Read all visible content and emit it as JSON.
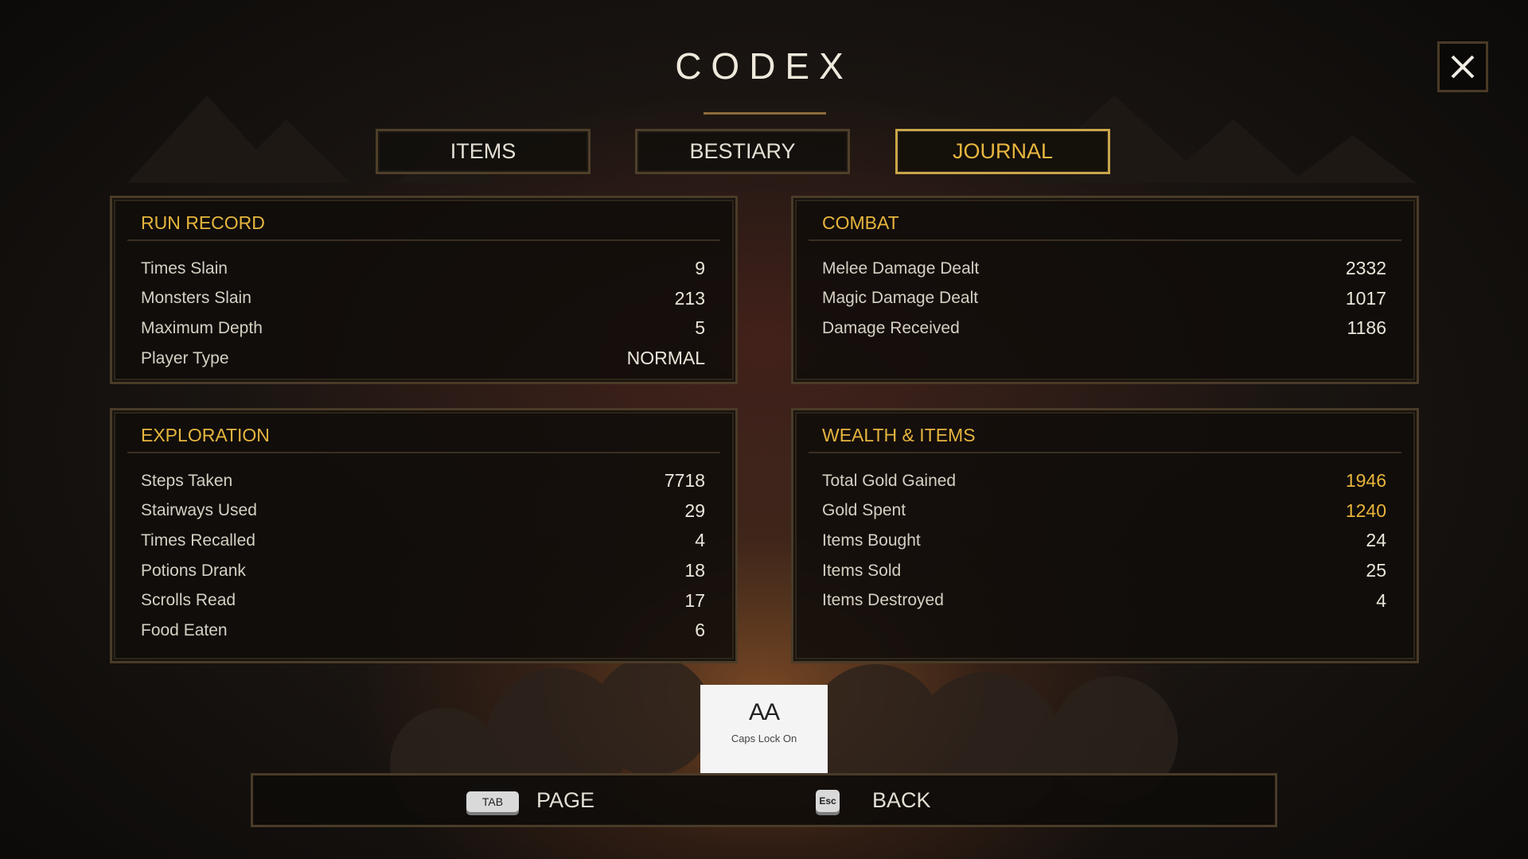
{
  "title": "CODEX",
  "tabs": [
    {
      "label": "ITEMS",
      "active": false
    },
    {
      "label": "BESTIARY",
      "active": false
    },
    {
      "label": "JOURNAL",
      "active": true
    }
  ],
  "panels": {
    "run_record": {
      "title": "RUN RECORD",
      "rows": [
        {
          "label": "Times Slain",
          "value": "9"
        },
        {
          "label": "Monsters Slain",
          "value": "213"
        },
        {
          "label": "Maximum Depth",
          "value": "5"
        },
        {
          "label": "Player Type",
          "value": "NORMAL"
        }
      ]
    },
    "combat": {
      "title": "COMBAT",
      "rows": [
        {
          "label": "Melee Damage Dealt",
          "value": "2332"
        },
        {
          "label": "Magic Damage Dealt",
          "value": "1017"
        },
        {
          "label": "Damage Received",
          "value": "1186"
        }
      ]
    },
    "exploration": {
      "title": "EXPLORATION",
      "rows": [
        {
          "label": "Steps Taken",
          "value": "7718"
        },
        {
          "label": "Stairways Used",
          "value": "29"
        },
        {
          "label": "Times Recalled",
          "value": "4"
        },
        {
          "label": "Potions Drank",
          "value": "18"
        },
        {
          "label": "Scrolls Read",
          "value": "17"
        },
        {
          "label": "Food Eaten",
          "value": "6"
        }
      ]
    },
    "wealth": {
      "title": "WEALTH & ITEMS",
      "rows": [
        {
          "label": "Total Gold Gained",
          "value": "1946"
        },
        {
          "label": "Gold Spent",
          "value": "1240"
        },
        {
          "label": "Items Bought",
          "value": "24"
        },
        {
          "label": "Items Sold",
          "value": "25"
        },
        {
          "label": "Items Destroyed",
          "value": "4"
        }
      ]
    }
  },
  "caps_lock": {
    "glyph": "AA",
    "text": "Caps Lock On"
  },
  "footer": {
    "page_key": "TAB",
    "page_label": "PAGE",
    "back_key": "Esc",
    "back_label": "BACK"
  },
  "colors": {
    "accent": "#e8b43a",
    "border": "#4a3b28",
    "active_border": "#caa54a"
  },
  "icons": {
    "close": "close-icon"
  }
}
